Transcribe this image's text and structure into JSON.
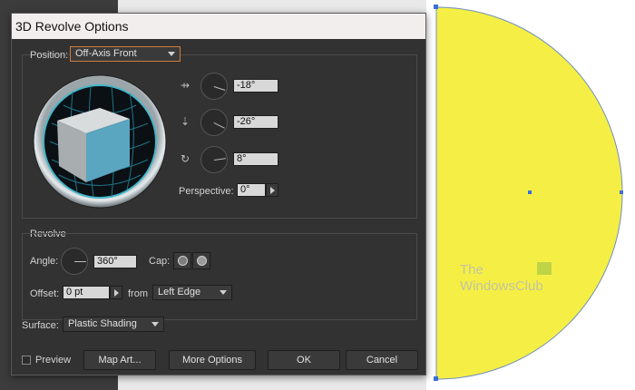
{
  "dialog": {
    "title": "3D Revolve Options",
    "position": {
      "label": "Position:",
      "value": "Off-Axis Front",
      "x_rotation": "-18°",
      "y_rotation": "-26°",
      "z_rotation": "8°",
      "perspective_label": "Perspective:",
      "perspective_value": "0°"
    },
    "revolve": {
      "section_label": "Revolve",
      "angle_label": "Angle:",
      "angle_value": "360°",
      "cap_label": "Cap:",
      "offset_label": "Offset:",
      "offset_value": "0 pt",
      "from_label": "from",
      "from_value": "Left Edge"
    },
    "surface": {
      "label": "Surface:",
      "value": "Plastic Shading"
    },
    "buttons": {
      "preview_label": "Preview",
      "map_art": "Map Art...",
      "more_options": "More Options",
      "ok": "OK",
      "cancel": "Cancel"
    }
  },
  "watermark": {
    "line1": "The",
    "line2": "WindowsClub"
  },
  "colors": {
    "shape_fill": "#f5ef45",
    "selection": "#3b6fd8",
    "cube_front": "#5aa5bf",
    "dialog_bg": "#323232"
  }
}
